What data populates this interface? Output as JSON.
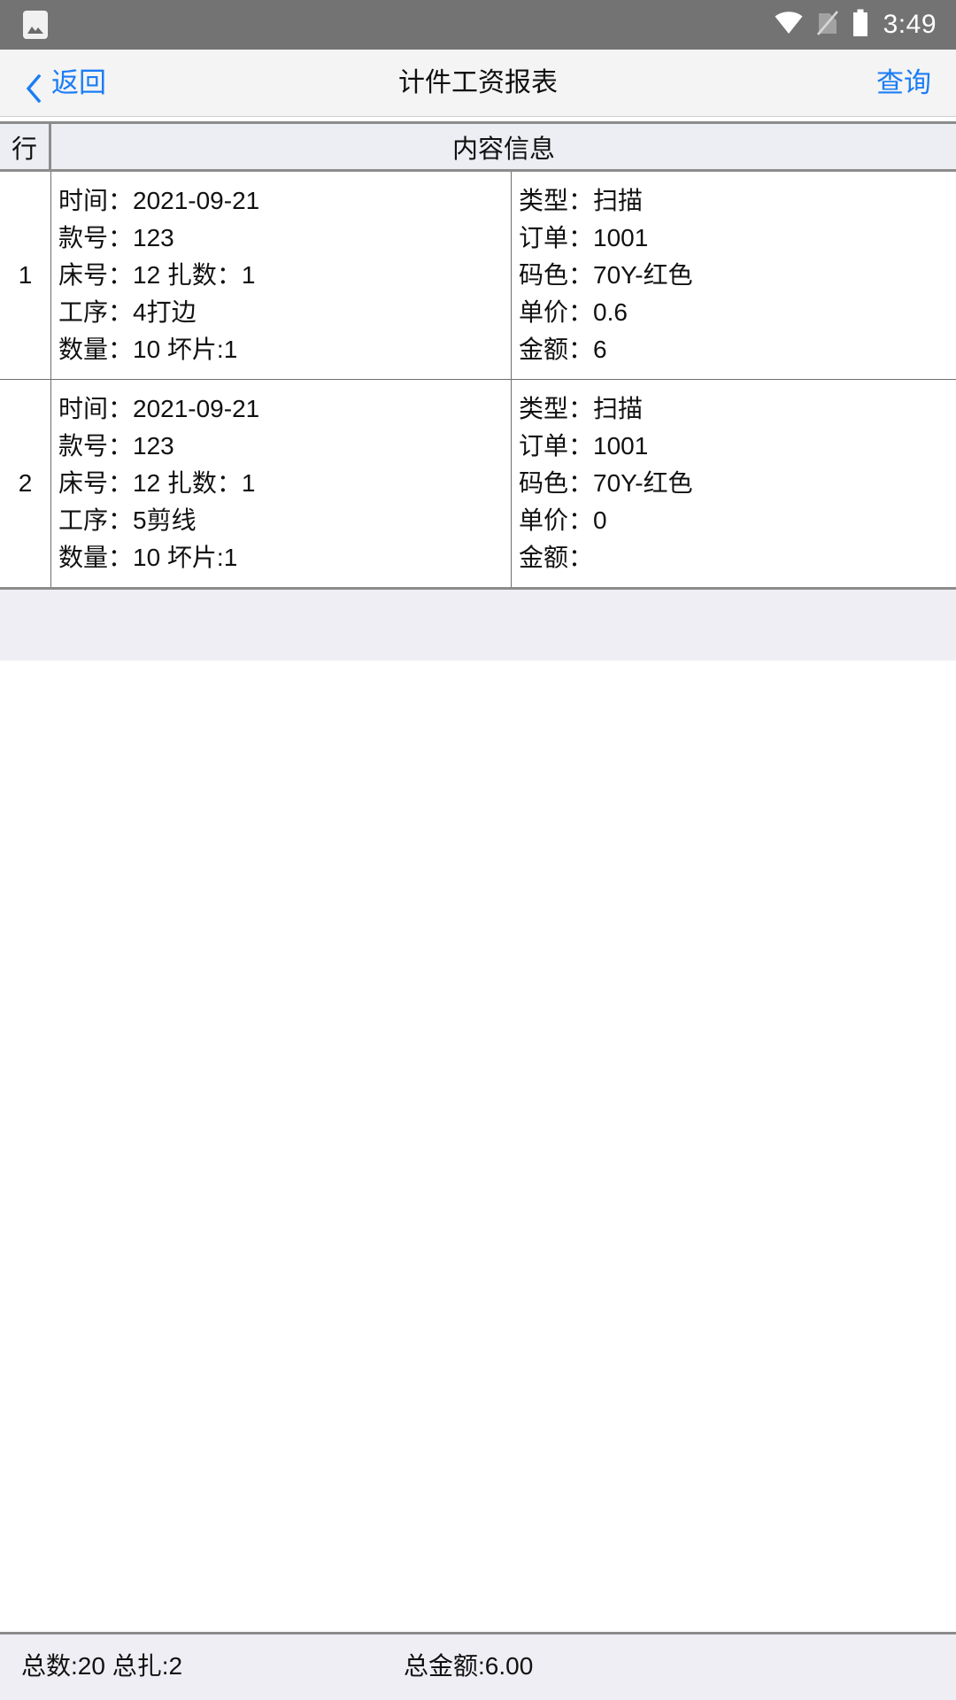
{
  "status_bar": {
    "notification_icon": "image-notification-icon",
    "wifi_icon": "wifi-icon",
    "sim_icon": "no-sim-card-icon",
    "battery_icon": "battery-full-icon",
    "time": "3:49",
    "background_color": "#737373"
  },
  "nav_bar": {
    "back_icon": "chevron-left-icon",
    "back_label": "返回",
    "title": "计件工资报表",
    "action_label": "查询",
    "accent_color": "#1b7df5",
    "background_color": "#f4f4f4"
  },
  "table": {
    "headers": {
      "row_number": "行",
      "content": "内容信息"
    },
    "rows": [
      {
        "index": "1",
        "left": [
          "时间：2021-09-21",
          "款号：123",
          "床号：12 扎数：1",
          "工序：4打边",
          "数量：10 坏片:1"
        ],
        "right": [
          "类型：扫描",
          "订单：1001",
          "码色：70Y-红色",
          "单价：0.6",
          "金额：6"
        ]
      },
      {
        "index": "2",
        "left": [
          "时间：2021-09-21",
          "款号：123",
          "床号：12 扎数：1",
          "工序：5剪线",
          "数量：10 坏片:1"
        ],
        "right": [
          "类型：扫描",
          "订单：1001",
          "码色：70Y-红色",
          "单价：0",
          "金额："
        ]
      }
    ]
  },
  "summary_bar": {
    "totals_left": "总数:20 总扎:2",
    "totals_amount": "总金额:6.00",
    "background_color": "#eeeef4"
  }
}
